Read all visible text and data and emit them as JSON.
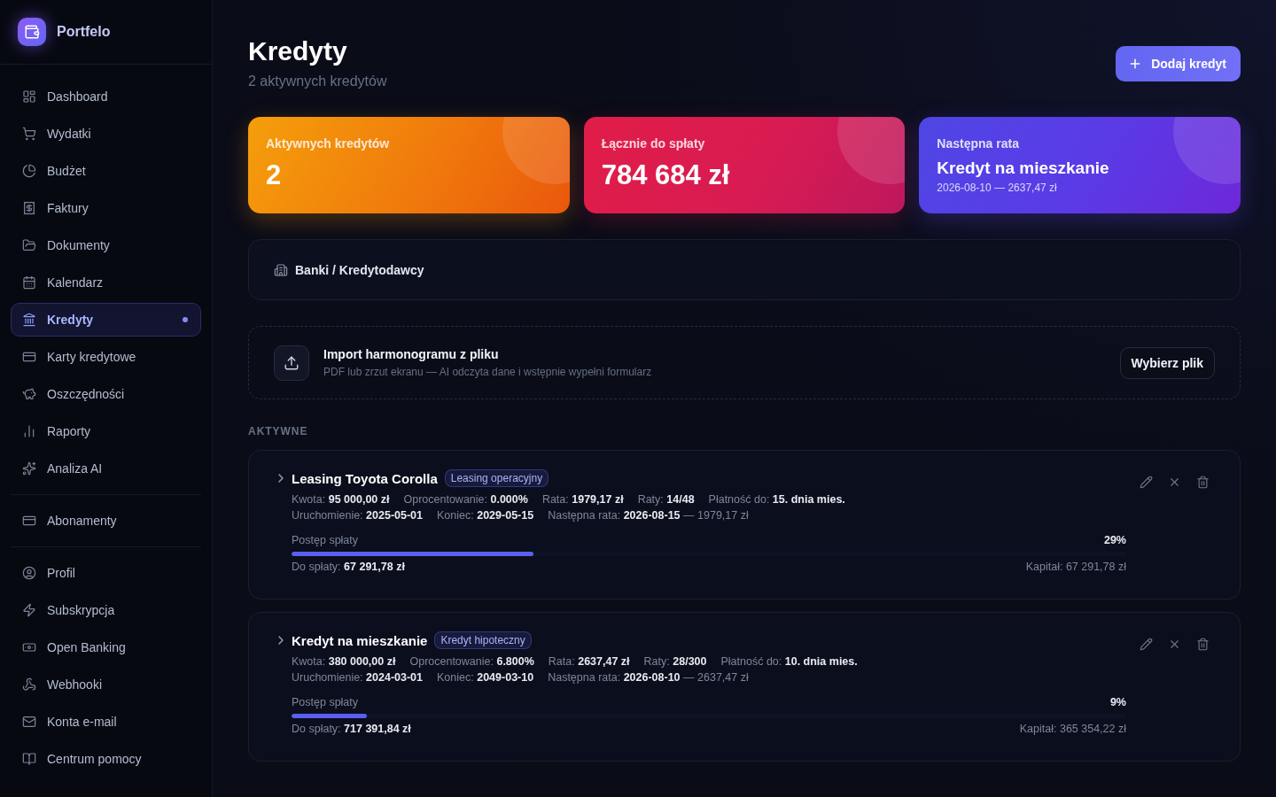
{
  "sidebar": {
    "brand": "Portfelo",
    "sections": [
      {
        "items": [
          {
            "label": "Dashboard",
            "selected": false
          },
          {
            "label": "Wydatki",
            "selected": false
          },
          {
            "label": "Budżet",
            "selected": false
          },
          {
            "label": "Faktury",
            "selected": false
          },
          {
            "label": "Dokumenty",
            "selected": false
          },
          {
            "label": "Kalendarz",
            "selected": false
          },
          {
            "label": "Kredyty",
            "selected": true
          },
          {
            "label": "Karty kredytowe",
            "selected": false
          },
          {
            "label": "Oszczędności",
            "selected": false
          },
          {
            "label": "Raporty",
            "selected": false
          },
          {
            "label": "Analiza AI",
            "selected": false
          }
        ]
      },
      {
        "items": [
          {
            "label": "Abonamenty",
            "selected": false
          }
        ]
      },
      {
        "items": [
          {
            "label": "Profil",
            "selected": false
          },
          {
            "label": "Subskrypcja",
            "selected": false
          },
          {
            "label": "Open Banking",
            "selected": false
          },
          {
            "label": "Webhooki",
            "selected": false
          },
          {
            "label": "Konta e-mail",
            "selected": false
          },
          {
            "label": "Centrum pomocy",
            "selected": false
          }
        ]
      }
    ]
  },
  "header": {
    "title": "Kredyty",
    "subtitle": "2 aktywnych kredytów",
    "button": "Dodaj kredyt"
  },
  "stats": [
    {
      "kind": "figure",
      "label": "Aktywnych kredytów",
      "value": "2"
    },
    {
      "kind": "figure",
      "label": "Łącznie do spłaty",
      "value": "784 684 zł"
    },
    {
      "kind": "loan",
      "label": "Następna rata",
      "value": "Kredyt na mieszkanie",
      "detail": "2026-08-10 — 2637,47 zł"
    }
  ],
  "banks_panel": {
    "title": "Banki / Kredytodawcy"
  },
  "import": {
    "title": "Import harmonogramu z pliku",
    "description": "PDF lub zrzut ekranu — AI odczyta dane i wstępnie wypełni formularz",
    "button": "Wybierz plik"
  },
  "section_label": "AKTYWNE",
  "loans": [
    {
      "name": "Leasing Toyota Corolla",
      "type": "Leasing operacyjny",
      "expanded": false,
      "detail_rows": [
        [
          "Kwota: **95 000,00 zł**",
          "Oprocentowanie: **0.000%**",
          "Rata: **1979,17 zł**",
          "Raty: **14/48**",
          "Płatność do: **15. dnia mies.**"
        ],
        [
          "Uruchomienie: **2025-05-01**",
          "Koniec: **2029-05-15**",
          "Następna rata: **2026-08-15** — 1979,17 zł"
        ]
      ],
      "progress": {
        "label": "Postęp spłaty",
        "percent": "29%",
        "level": 0.29
      },
      "remaining": "Do spłaty: **67 291,78 zł**",
      "capital": "Kapitał: 67 291,78 zł"
    },
    {
      "name": "Kredyt na mieszkanie",
      "type": "Kredyt hipoteczny",
      "expanded": false,
      "detail_rows": [
        [
          "Kwota: **380 000,00 zł**",
          "Oprocentowanie: **6.800%**",
          "Rata: **2637,47 zł**",
          "Raty: **28/300**",
          "Płatność do: **10. dnia mies.**"
        ],
        [
          "Uruchomienie: **2024-03-01**",
          "Koniec: **2049-03-10**",
          "Następna rata: **2026-08-10** — 2637,47 zł"
        ]
      ],
      "progress": {
        "label": "Postęp spłaty",
        "percent": "9%",
        "level": 0.09
      },
      "remaining": "Do spłaty: **717 391,84 zł**",
      "capital": "Kapitał: 365 354,22 zł"
    }
  ]
}
